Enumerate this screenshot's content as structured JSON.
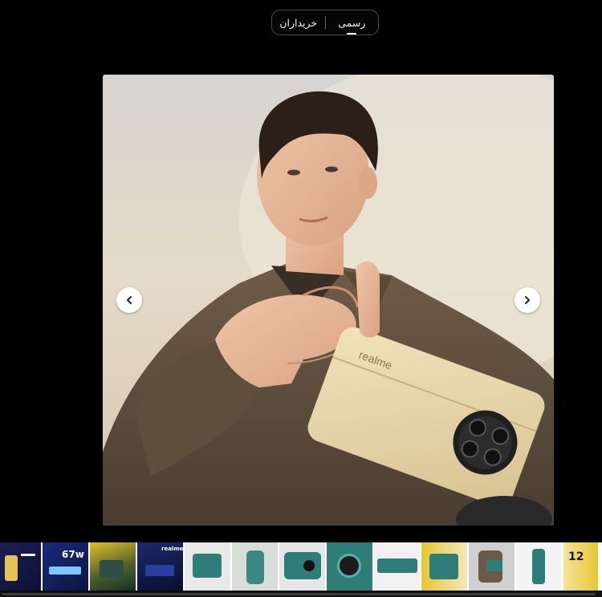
{
  "tabs": {
    "official_label": "رسمی",
    "buyers_label": "خریداران",
    "active": "official"
  },
  "viewer": {
    "phone_brand_text": "realme",
    "prev_icon": "chevron-left-icon",
    "next_icon": "chevron-right-icon"
  },
  "thumbnails": {
    "banner_67w_text": "67w",
    "banner_realme_text": "realme",
    "banner_12_text": "12"
  },
  "colors": {
    "background": "#000000",
    "phone_body": "#e6d3a8",
    "thumb_teal": "#2f7d79",
    "thumb_navy": "#1a2a6b"
  }
}
